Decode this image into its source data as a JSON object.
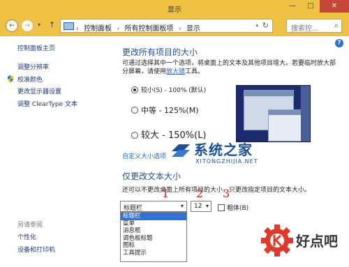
{
  "window": {
    "title": "显示",
    "min_glyph": "—",
    "max_glyph": "□",
    "close_glyph": "✕"
  },
  "nav": {
    "back_glyph": "←",
    "forward_glyph": "→",
    "dropdown_glyph": "▾",
    "up_glyph": "↑",
    "breadcrumbs": [
      "控制面板",
      "所有控制面板项",
      "显示"
    ],
    "separator": "›",
    "refresh_glyph": "↻",
    "search_placeholder": "搜索控...",
    "search_glyph": "⌕"
  },
  "sidebar": {
    "items": [
      {
        "label": "控制面板主页"
      },
      {
        "label": "调整分辨率"
      },
      {
        "label": "校准颜色"
      },
      {
        "label": "更改显示器设置"
      },
      {
        "label": "调整 ClearType 文本"
      }
    ],
    "see_also_label": "另请参阅",
    "see_also_items": [
      {
        "label": "个性化"
      },
      {
        "label": "设备和打印机"
      }
    ]
  },
  "help_glyph": "?",
  "size_section": {
    "heading": "更改所有项目的大小",
    "desc_before": "可通过选择其中一个选项，将桌面上的文本及其他项目增大。若要临时放大部分屏幕，请使用",
    "magnifier_link": "放大镜",
    "desc_after": "工具。",
    "options": [
      {
        "label": "较小(S) - 100% (默认)",
        "selected": true
      },
      {
        "label": "中等 - 125%(M)",
        "selected": false
      },
      {
        "label": "较大 - 150%(L)",
        "selected": false
      }
    ],
    "custom_link": "自定义大小选项"
  },
  "text_section": {
    "heading": "仅更改文本大小",
    "desc": "还可以不更改桌面上所有项目的大小，只更改指定项目的文本大小。",
    "item_select_value": "标题栏",
    "item_options": [
      "标题栏",
      "菜单",
      "消息框",
      "调色板标题",
      "图标",
      "工具提示"
    ],
    "font_size_value": "12",
    "bold_label": "粗体(B)",
    "arrow_glyph": "▾"
  },
  "annotations": {
    "n1": "1",
    "n2": "2",
    "n3": "3"
  },
  "watermark": {
    "title": "系统之家",
    "url": "XITONGZHIJIA.NET"
  },
  "badge": {
    "text": "好点吧"
  },
  "colors": {
    "titlebar": "#f0c244",
    "close_button": "#c7463a",
    "link": "#1f3a73",
    "heading": "#1f4e9e",
    "annotation_red": "#d0241c",
    "list_highlight": "#3072d6"
  }
}
